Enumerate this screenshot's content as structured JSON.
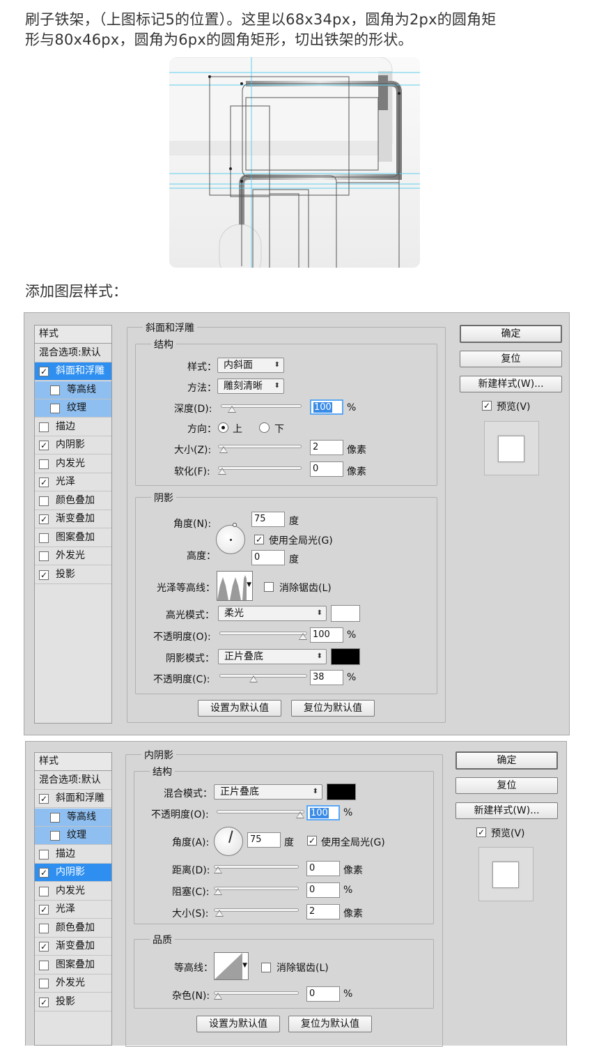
{
  "article": {
    "intro_line1": "刷子铁架，（上图标记5的位置）。这里以68x34px，圆角为2px的圆角矩",
    "intro_line2": "形与80x46px，圆角为6px的圆角矩形，切出铁架的形状。",
    "subtitle": "添加图层样式："
  },
  "dialog1": {
    "style_list": {
      "header": "样式",
      "blend_options": "混合选项:默认",
      "items": [
        {
          "label": "斜面和浮雕",
          "checked": true,
          "selected": true,
          "sub": false
        },
        {
          "label": "等高线",
          "checked": false,
          "selected": false,
          "sub": true
        },
        {
          "label": "纹理",
          "checked": false,
          "selected": false,
          "sub": true
        },
        {
          "label": "描边",
          "checked": false,
          "selected": false,
          "sub": false
        },
        {
          "label": "内阴影",
          "checked": true,
          "selected": false,
          "sub": false
        },
        {
          "label": "内发光",
          "checked": false,
          "selected": false,
          "sub": false
        },
        {
          "label": "光泽",
          "checked": true,
          "selected": false,
          "sub": false
        },
        {
          "label": "颜色叠加",
          "checked": false,
          "selected": false,
          "sub": false
        },
        {
          "label": "渐变叠加",
          "checked": true,
          "selected": false,
          "sub": false
        },
        {
          "label": "图案叠加",
          "checked": false,
          "selected": false,
          "sub": false
        },
        {
          "label": "外发光",
          "checked": false,
          "selected": false,
          "sub": false
        },
        {
          "label": "投影",
          "checked": true,
          "selected": false,
          "sub": false
        }
      ]
    },
    "panel_title": "斜面和浮雕",
    "structure": {
      "title": "结构",
      "style_label": "样式：",
      "style_value": "内斜面",
      "technique_label": "方法：",
      "technique_value": "雕刻清晰",
      "depth_label": "深度(D):",
      "depth_value": "100",
      "depth_unit": "%",
      "depth_pct": 0.1,
      "direction_label": "方向：",
      "dir_up": "上",
      "dir_down": "下",
      "size_label": "大小(Z):",
      "size_value": "2",
      "size_unit": "像素",
      "size_pct": 0.02,
      "soften_label": "软化(F):",
      "soften_value": "0",
      "soften_unit": "像素",
      "soften_pct": 0.0
    },
    "shading": {
      "title": "阴影",
      "angle_label": "角度(N):",
      "angle_value": "75",
      "angle_unit": "度",
      "global_light": "使用全局光(G)",
      "altitude_label": "高度：",
      "altitude_value": "0",
      "altitude_unit": "度",
      "gloss_label": "光泽等高线：",
      "anti_alias": "消除锯齿(L)",
      "highlight_label": "高光模式：",
      "highlight_value": "柔光",
      "highlight_color": "#ffffff",
      "hl_opacity_label": "不透明度(O):",
      "hl_opacity_value": "100",
      "hl_opacity_unit": "%",
      "hl_opacity_pct": 1.0,
      "shadow_label": "阴影模式：",
      "shadow_value": "正片叠底",
      "shadow_color": "#000000",
      "sh_opacity_label": "不透明度(C):",
      "sh_opacity_value": "38",
      "sh_opacity_unit": "%",
      "sh_opacity_pct": 0.38
    },
    "set_default": "设置为默认值",
    "reset_default": "复位为默认值",
    "ok": "确定",
    "reset": "复位",
    "new_style": "新建样式(W)...",
    "preview": "预览(V)"
  },
  "dialog2": {
    "style_list": {
      "header": "样式",
      "blend_options": "混合选项:默认",
      "items": [
        {
          "label": "斜面和浮雕",
          "checked": true,
          "selected": false,
          "sub": false
        },
        {
          "label": "等高线",
          "checked": false,
          "selected": false,
          "sub": true
        },
        {
          "label": "纹理",
          "checked": false,
          "selected": false,
          "sub": true
        },
        {
          "label": "描边",
          "checked": false,
          "selected": false,
          "sub": false
        },
        {
          "label": "内阴影",
          "checked": true,
          "selected": true,
          "sub": false
        },
        {
          "label": "内发光",
          "checked": false,
          "selected": false,
          "sub": false
        },
        {
          "label": "光泽",
          "checked": true,
          "selected": false,
          "sub": false
        },
        {
          "label": "颜色叠加",
          "checked": false,
          "selected": false,
          "sub": false
        },
        {
          "label": "渐变叠加",
          "checked": true,
          "selected": false,
          "sub": false
        },
        {
          "label": "图案叠加",
          "checked": false,
          "selected": false,
          "sub": false
        },
        {
          "label": "外发光",
          "checked": false,
          "selected": false,
          "sub": false
        },
        {
          "label": "投影",
          "checked": true,
          "selected": false,
          "sub": false
        }
      ]
    },
    "panel_title": "内阴影",
    "structure": {
      "title": "结构",
      "blend_label": "混合模式：",
      "blend_value": "正片叠底",
      "blend_color": "#000000",
      "opacity_label": "不透明度(O):",
      "opacity_value": "100",
      "opacity_unit": "%",
      "opacity_pct": 1.0,
      "angle_label": "角度(A):",
      "angle_value": "75",
      "angle_unit": "度",
      "global_light": "使用全局光(G)",
      "distance_label": "距离(D):",
      "distance_value": "0",
      "distance_unit": "像素",
      "distance_pct": 0.0,
      "choke_label": "阻塞(C):",
      "choke_value": "0",
      "choke_unit": "%",
      "choke_pct": 0.0,
      "size_label": "大小(S):",
      "size_value": "2",
      "size_unit": "像素",
      "size_pct": 0.02
    },
    "quality": {
      "title": "品质",
      "contour_label": "等高线：",
      "anti_alias": "消除锯齿(L)",
      "noise_label": "杂色(N):",
      "noise_value": "0",
      "noise_unit": "%",
      "noise_pct": 0.0
    },
    "set_default": "设置为默认值",
    "reset_default": "复位为默认值",
    "ok": "确定",
    "reset": "复位",
    "new_style": "新建样式(W)...",
    "preview": "预览(V)"
  }
}
